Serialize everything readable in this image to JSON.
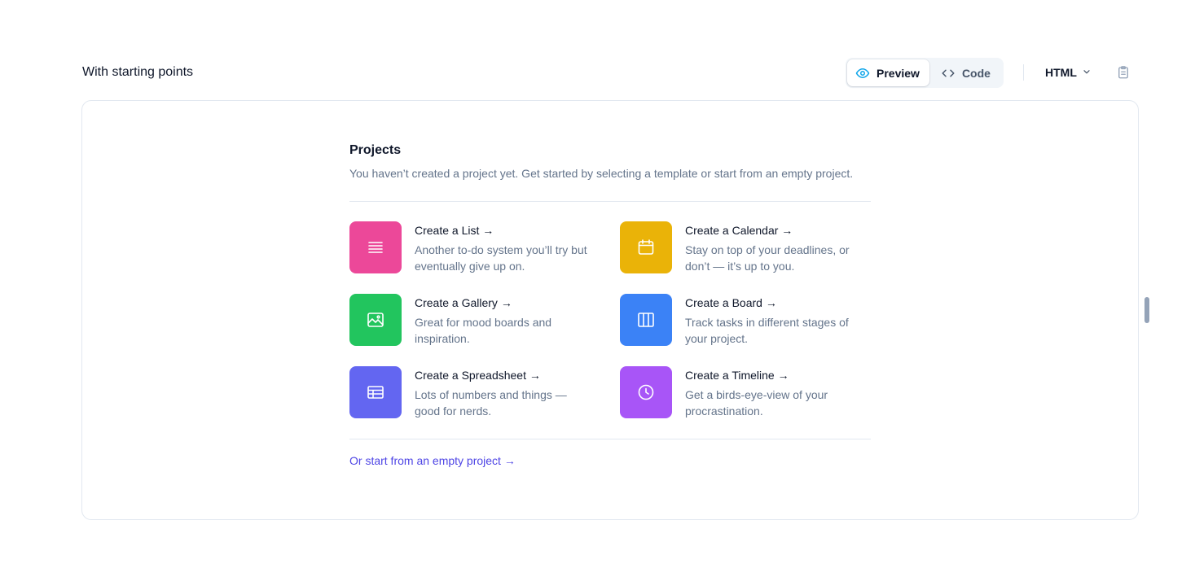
{
  "section": {
    "heading": "With starting points"
  },
  "toolbar": {
    "preview_label": "Preview",
    "code_label": "Code",
    "language": "HTML",
    "colors": {
      "preview_icon": "#0ea5e9"
    }
  },
  "projects": {
    "title": "Projects",
    "description": "You haven’t created a project yet. Get started by selecting a template or start from an empty project.",
    "items": [
      {
        "title": "Create a List →",
        "description": "Another to-do system you’ll try but eventually give up on.",
        "icon": "list-icon",
        "color": "#ec4899"
      },
      {
        "title": "Create a Calendar →",
        "description": "Stay on top of your deadlines, or don’t — it’s up to you.",
        "icon": "calendar-icon",
        "color": "#eab308"
      },
      {
        "title": "Create a Gallery →",
        "description": "Great for mood boards and inspiration.",
        "icon": "photo-icon",
        "color": "#22c55e"
      },
      {
        "title": "Create a Board →",
        "description": "Track tasks in different stages of your project.",
        "icon": "columns-icon",
        "color": "#3b82f6"
      },
      {
        "title": "Create a Spreadsheet →",
        "description": "Lots of numbers and things — good for nerds.",
        "icon": "table-icon",
        "color": "#6366f1"
      },
      {
        "title": "Create a Timeline →",
        "description": "Get a birds-eye-view of your procrastination.",
        "icon": "clock-icon",
        "color": "#a855f7"
      }
    ],
    "empty_link": "Or start from an empty project →"
  }
}
